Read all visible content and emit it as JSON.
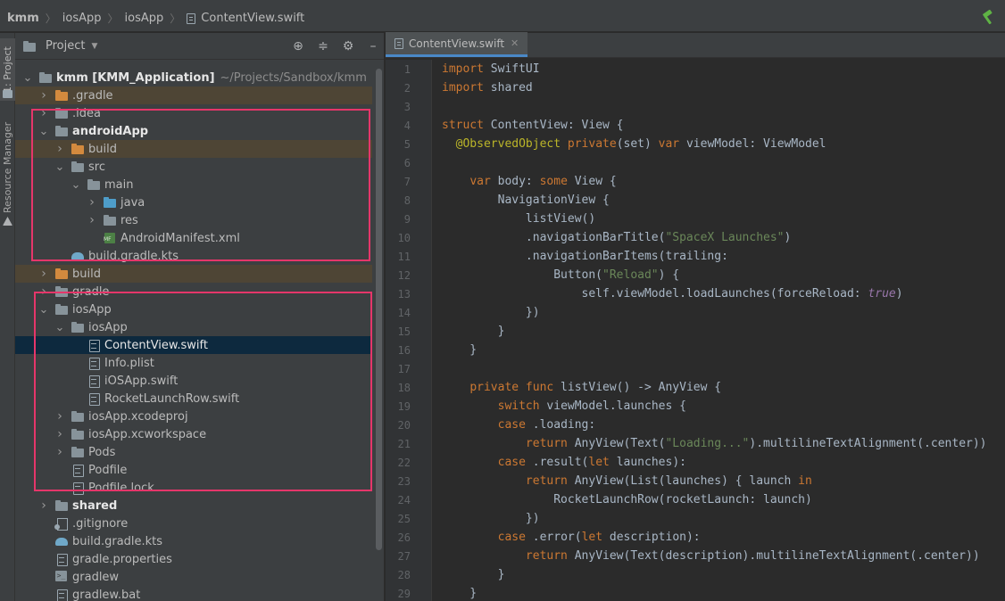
{
  "breadcrumb": [
    "kmm",
    "iosApp",
    "iosApp",
    "ContentView.swift"
  ],
  "tool_strip": {
    "project_tab": "1: Project",
    "resource_tab": "Resource Manager"
  },
  "project_panel": {
    "title": "Project",
    "icons": [
      "target-icon",
      "collapse-icon",
      "gear-icon",
      "minimize-icon"
    ]
  },
  "tree": [
    {
      "depth": 0,
      "arrow": "down",
      "icon": "folder-module",
      "label": "kmm [KMM_Application]",
      "note": "~/Projects/Sandbox/kmm",
      "bold": true
    },
    {
      "depth": 1,
      "arrow": "right",
      "icon": "folder-orange",
      "label": ".gradle",
      "sel": "brown"
    },
    {
      "depth": 1,
      "arrow": "right",
      "icon": "folder",
      "label": ".idea"
    },
    {
      "depth": 1,
      "arrow": "down",
      "icon": "folder-module",
      "label": "androidApp",
      "bold": true
    },
    {
      "depth": 2,
      "arrow": "right",
      "icon": "folder-orange",
      "label": "build",
      "sel": "brown"
    },
    {
      "depth": 2,
      "arrow": "down",
      "icon": "folder",
      "label": "src"
    },
    {
      "depth": 3,
      "arrow": "down",
      "icon": "folder",
      "label": "main"
    },
    {
      "depth": 4,
      "arrow": "right",
      "icon": "folder-blue",
      "label": "java"
    },
    {
      "depth": 4,
      "arrow": "right",
      "icon": "folder",
      "label": "res"
    },
    {
      "depth": 4,
      "arrow": "none",
      "icon": "xml",
      "label": "AndroidManifest.xml"
    },
    {
      "depth": 2,
      "arrow": "none",
      "icon": "gradle",
      "label": "build.gradle.kts"
    },
    {
      "depth": 1,
      "arrow": "right",
      "icon": "folder-orange",
      "label": "build",
      "sel": "brown"
    },
    {
      "depth": 1,
      "arrow": "right",
      "icon": "folder",
      "label": "gradle"
    },
    {
      "depth": 1,
      "arrow": "down",
      "icon": "folder",
      "label": "iosApp"
    },
    {
      "depth": 2,
      "arrow": "down",
      "icon": "folder",
      "label": "iosApp"
    },
    {
      "depth": 3,
      "arrow": "none",
      "icon": "file",
      "label": "ContentView.swift",
      "sel": "blue"
    },
    {
      "depth": 3,
      "arrow": "none",
      "icon": "file",
      "label": "Info.plist"
    },
    {
      "depth": 3,
      "arrow": "none",
      "icon": "file",
      "label": "iOSApp.swift"
    },
    {
      "depth": 3,
      "arrow": "none",
      "icon": "file",
      "label": "RocketLaunchRow.swift"
    },
    {
      "depth": 2,
      "arrow": "right",
      "icon": "folder",
      "label": "iosApp.xcodeproj"
    },
    {
      "depth": 2,
      "arrow": "right",
      "icon": "folder",
      "label": "iosApp.xcworkspace"
    },
    {
      "depth": 2,
      "arrow": "right",
      "icon": "folder",
      "label": "Pods"
    },
    {
      "depth": 2,
      "arrow": "none",
      "icon": "file",
      "label": "Podfile"
    },
    {
      "depth": 2,
      "arrow": "none",
      "icon": "file",
      "label": "Podfile.lock"
    },
    {
      "depth": 1,
      "arrow": "right",
      "icon": "folder-module",
      "label": "shared",
      "bold": true
    },
    {
      "depth": 1,
      "arrow": "none",
      "icon": "git",
      "label": ".gitignore"
    },
    {
      "depth": 1,
      "arrow": "none",
      "icon": "gradle",
      "label": "build.gradle.kts"
    },
    {
      "depth": 1,
      "arrow": "none",
      "icon": "file",
      "label": "gradle.properties"
    },
    {
      "depth": 1,
      "arrow": "none",
      "icon": "term",
      "label": "gradlew"
    },
    {
      "depth": 1,
      "arrow": "none",
      "icon": "file",
      "label": "gradlew.bat"
    }
  ],
  "editor": {
    "tab_label": "ContentView.swift",
    "lines": [
      [
        [
          "kw",
          "import"
        ],
        [
          "t",
          " SwiftUI"
        ]
      ],
      [
        [
          "kw",
          "import"
        ],
        [
          "t",
          " shared"
        ]
      ],
      [],
      [
        [
          "kw",
          "struct"
        ],
        [
          "t",
          " ContentView: View {"
        ]
      ],
      [
        [
          "t",
          "  "
        ],
        [
          "ann",
          "@ObservedObject"
        ],
        [
          "t",
          " "
        ],
        [
          "kw",
          "private"
        ],
        [
          "t",
          "(set) "
        ],
        [
          "kw",
          "var"
        ],
        [
          "t",
          " viewModel: ViewModel"
        ]
      ],
      [],
      [
        [
          "t",
          "    "
        ],
        [
          "kw",
          "var"
        ],
        [
          "t",
          " body: "
        ],
        [
          "kw",
          "some"
        ],
        [
          "t",
          " View {"
        ]
      ],
      [
        [
          "t",
          "        NavigationView {"
        ]
      ],
      [
        [
          "t",
          "            listView()"
        ]
      ],
      [
        [
          "t",
          "            .navigationBarTitle("
        ],
        [
          "str",
          "\"SpaceX Launches\""
        ],
        [
          "t",
          ")"
        ]
      ],
      [
        [
          "t",
          "            .navigationBarItems(trailing:"
        ]
      ],
      [
        [
          "t",
          "                Button("
        ],
        [
          "str",
          "\"Reload\""
        ],
        [
          "t",
          ") {"
        ]
      ],
      [
        [
          "t",
          "                    self.viewModel.loadLaunches(forceReload: "
        ],
        [
          "ital",
          "true"
        ],
        [
          "t",
          ")"
        ]
      ],
      [
        [
          "t",
          "            })"
        ]
      ],
      [
        [
          "t",
          "        }"
        ]
      ],
      [
        [
          "t",
          "    }"
        ]
      ],
      [],
      [
        [
          "t",
          "    "
        ],
        [
          "kw",
          "private func"
        ],
        [
          "t",
          " listView() -> AnyView {"
        ]
      ],
      [
        [
          "t",
          "        "
        ],
        [
          "kw",
          "switch"
        ],
        [
          "t",
          " viewModel.launches {"
        ]
      ],
      [
        [
          "t",
          "        "
        ],
        [
          "kw",
          "case"
        ],
        [
          "t",
          " .loading:"
        ]
      ],
      [
        [
          "t",
          "            "
        ],
        [
          "kw",
          "return"
        ],
        [
          "t",
          " AnyView(Text("
        ],
        [
          "str",
          "\"Loading...\""
        ],
        [
          "t",
          ").multilineTextAlignment(.center))"
        ]
      ],
      [
        [
          "t",
          "        "
        ],
        [
          "kw",
          "case"
        ],
        [
          "t",
          " .result("
        ],
        [
          "kw",
          "let"
        ],
        [
          "t",
          " launches):"
        ]
      ],
      [
        [
          "t",
          "            "
        ],
        [
          "kw",
          "return"
        ],
        [
          "t",
          " AnyView(List(launches) { launch "
        ],
        [
          "kw",
          "in"
        ]
      ],
      [
        [
          "t",
          "                RocketLaunchRow(rocketLaunch: launch)"
        ]
      ],
      [
        [
          "t",
          "            })"
        ]
      ],
      [
        [
          "t",
          "        "
        ],
        [
          "kw",
          "case"
        ],
        [
          "t",
          " .error("
        ],
        [
          "kw",
          "let"
        ],
        [
          "t",
          " description):"
        ]
      ],
      [
        [
          "t",
          "            "
        ],
        [
          "kw",
          "return"
        ],
        [
          "t",
          " AnyView(Text(description).multilineTextAlignment(.center))"
        ]
      ],
      [
        [
          "t",
          "        }"
        ]
      ],
      [
        [
          "t",
          "    }"
        ]
      ]
    ],
    "line_numbers": [
      "1",
      "2",
      "3",
      "4",
      "5",
      "6",
      "7",
      "8",
      "9",
      "10",
      "11",
      "12",
      "13",
      "14",
      "15",
      "16",
      "17",
      "18",
      "19",
      "20",
      "21",
      "22",
      "23",
      "24",
      "25",
      "26",
      "27",
      "28",
      "29"
    ]
  },
  "colors": {
    "keyword": "#cc7832",
    "string": "#6a8759",
    "annotation": "#bbb529",
    "literal": "#9876aa",
    "highlight_box": "#e5366a",
    "selection": "#0d293e",
    "excluded_row": "#4e4535"
  }
}
